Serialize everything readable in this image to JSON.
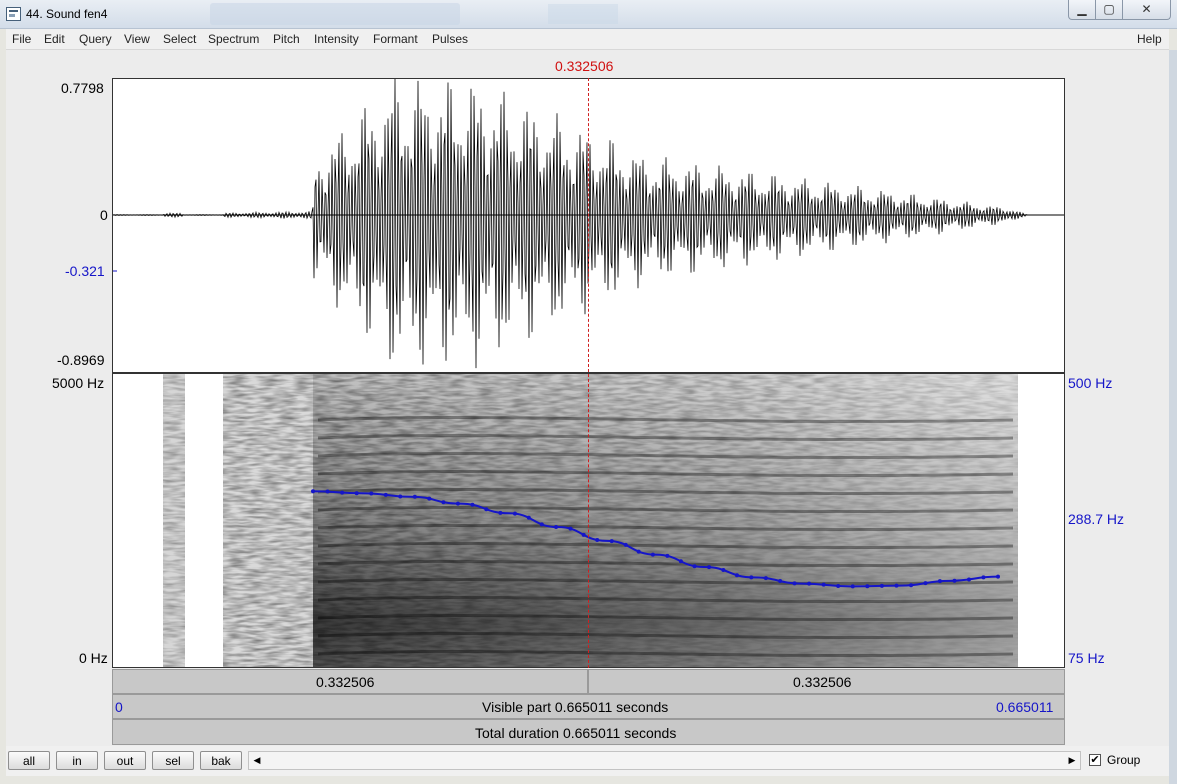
{
  "window": {
    "title": "44. Sound fen4"
  },
  "menu": [
    "File",
    "Edit",
    "Query",
    "View",
    "Select",
    "Spectrum",
    "Pitch",
    "Intensity",
    "Formant",
    "Pulses"
  ],
  "help_label": "Help",
  "cursor": {
    "time_label": "0.332506"
  },
  "waveform": {
    "y_max": "0.7798",
    "y_zero": "0",
    "y_cursor": "-0.321",
    "y_min": "-0.8969"
  },
  "spectrogram": {
    "freq_max": "5000 Hz",
    "freq_min": "0 Hz"
  },
  "pitch": {
    "top": "500 Hz",
    "cursor": "288.7 Hz",
    "bottom": "75 Hz",
    "contour_hz": [
      330,
      327,
      322,
      312,
      298,
      278,
      258,
      238,
      220,
      205,
      196,
      192,
      193,
      200,
      206
    ]
  },
  "timebar": {
    "left_segment": "0.332506",
    "right_segment": "0.332506",
    "visible_start": "0",
    "visible_part": "Visible part 0.665011 seconds",
    "visible_end": "0.665011",
    "total_duration": "Total duration 0.665011 seconds"
  },
  "buttons": {
    "all": "all",
    "in": "in",
    "out": "out",
    "sel": "sel",
    "bak": "bak"
  },
  "group": {
    "label": "Group",
    "checked": true,
    "check_glyph": "✔"
  },
  "colors": {
    "cursor": "#d01010",
    "pitch": "#1515c8",
    "title_bg": "#dfe7f0"
  },
  "icons": [
    "app-icon",
    "minimize-icon",
    "maximize-icon",
    "close-icon",
    "scroll-left-icon",
    "scroll-right-icon",
    "checkbox-icon"
  ]
}
